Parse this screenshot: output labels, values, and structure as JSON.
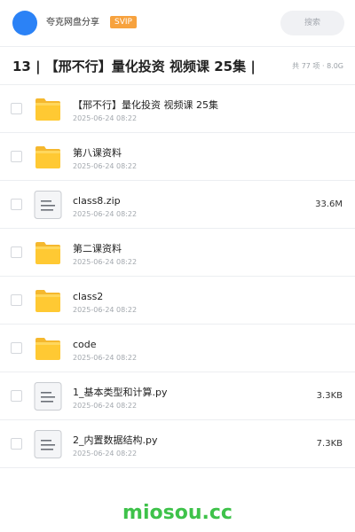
{
  "header": {
    "user_name": "夸克网盘分享",
    "vip_label": "SVIP",
    "search_label": "搜索"
  },
  "folder": {
    "title": "13 | 【邢不行】量化投资 视频课 25集 |",
    "summary": "共 77 项 · 8.0G"
  },
  "files": [
    {
      "type": "folder",
      "icon": "folder-icon",
      "name": "【邢不行】量化投资 视频课 25集",
      "date": "2025-06-24 08:22",
      "size": ""
    },
    {
      "type": "folder",
      "icon": "folder-icon",
      "name": "第八课资料",
      "date": "2025-06-24 08:22",
      "size": ""
    },
    {
      "type": "file",
      "icon": "file-icon",
      "name": "class8.zip",
      "date": "2025-06-24 08:22",
      "size": "33.6M"
    },
    {
      "type": "folder",
      "icon": "folder-icon",
      "name": "第二课资料",
      "date": "2025-06-24 08:22",
      "size": ""
    },
    {
      "type": "folder",
      "icon": "folder-icon",
      "name": "class2",
      "date": "2025-06-24 08:22",
      "size": ""
    },
    {
      "type": "folder",
      "icon": "folder-icon",
      "name": "code",
      "date": "2025-06-24 08:22",
      "size": ""
    },
    {
      "type": "file",
      "icon": "file-icon",
      "name": "1_基本类型和计算.py",
      "date": "2025-06-24 08:22",
      "size": "3.3KB"
    },
    {
      "type": "file",
      "icon": "file-icon",
      "name": "2_内置数据结构.py",
      "date": "2025-06-24 08:22",
      "size": "7.3KB"
    }
  ],
  "footer": {
    "brand": "miosou.cc"
  },
  "colors": {
    "accent": "#2b82f6",
    "vip": "#f7a23e",
    "folder": "#ffc933",
    "brand": "#3ec24a"
  }
}
